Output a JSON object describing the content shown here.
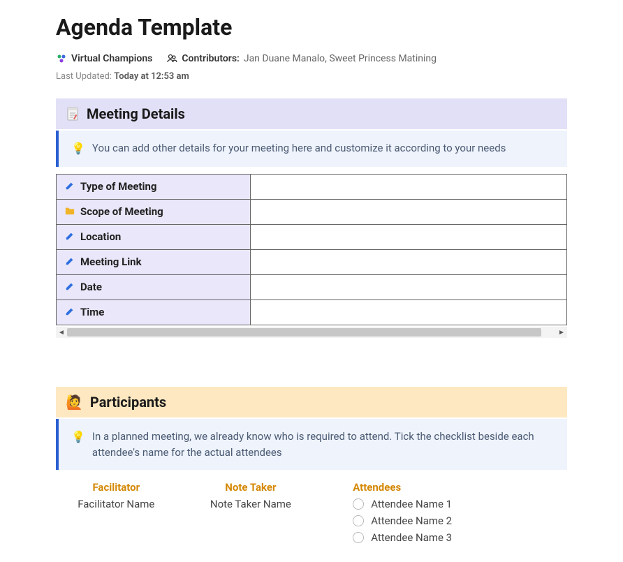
{
  "title": "Agenda Template",
  "workspace": {
    "name": "Virtual Champions"
  },
  "contributors": {
    "label": "Contributors:",
    "names": "Jan Duane Manalo, Sweet Princess Matining"
  },
  "last_updated": {
    "prefix": "Last Updated: ",
    "time": "Today at 12:53 am"
  },
  "meeting_details": {
    "heading": "Meeting Details",
    "tip": "You can add other details for your meeting here and customize it according to your needs",
    "rows": [
      {
        "label": "Type of Meeting",
        "icon": "pencil",
        "value": ""
      },
      {
        "label": "Scope of Meeting",
        "icon": "folder",
        "value": ""
      },
      {
        "label": "Location",
        "icon": "pencil",
        "value": ""
      },
      {
        "label": "Meeting Link",
        "icon": "pencil",
        "value": ""
      },
      {
        "label": "Date",
        "icon": "pencil",
        "value": ""
      },
      {
        "label": "Time",
        "icon": "pencil",
        "value": ""
      }
    ]
  },
  "participants": {
    "heading": "Participants",
    "tip": "In a planned meeting, we already know who is required to attend. Tick the checklist beside each attendee's name for the actual attendees",
    "facilitator": {
      "header": "Facilitator",
      "name": "Facilitator Name"
    },
    "note_taker": {
      "header": "Note Taker",
      "name": "Note Taker Name"
    },
    "attendees": {
      "header": "Attendees",
      "list": [
        "Attendee Name 1",
        "Attendee Name 2",
        "Attendee Name 3"
      ]
    }
  }
}
